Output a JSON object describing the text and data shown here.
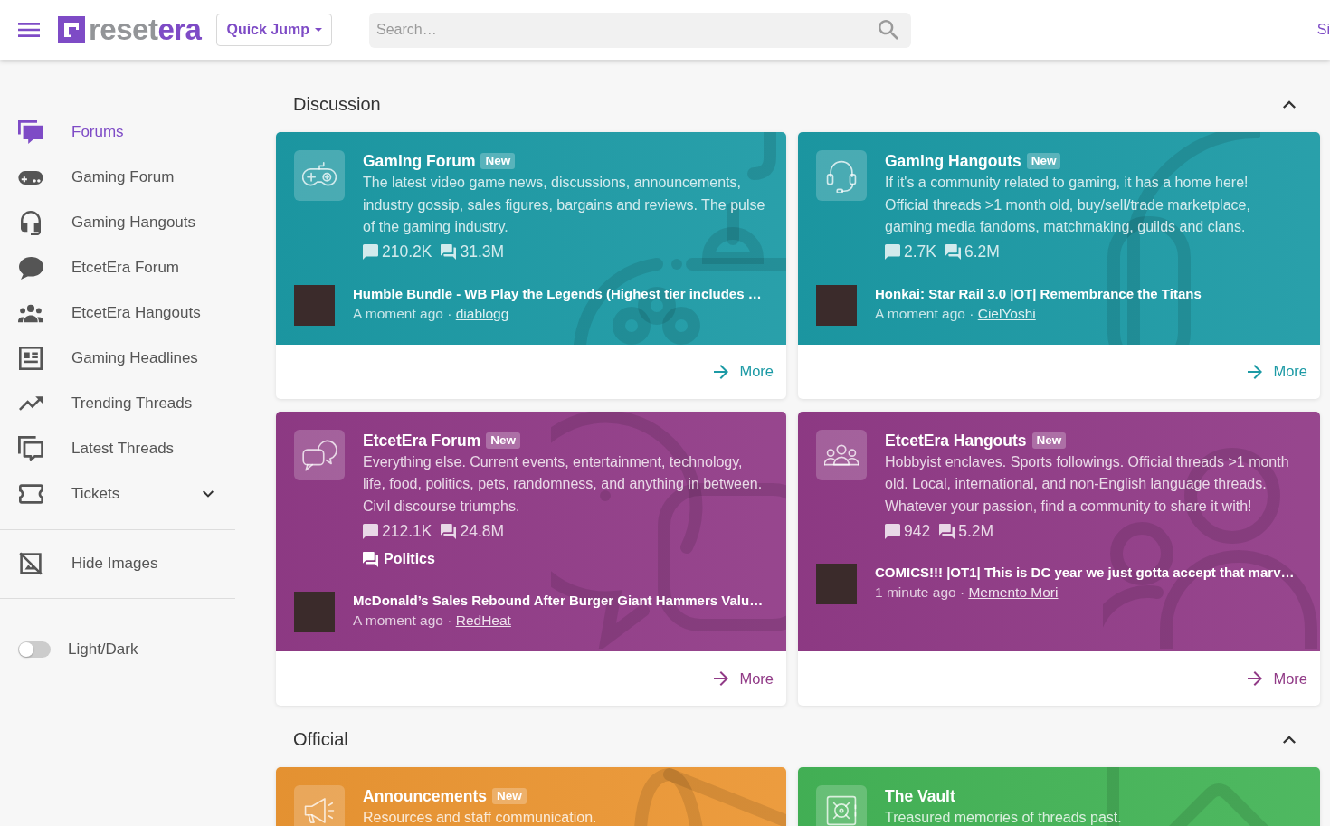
{
  "header": {
    "logo": {
      "wordmark": "reset",
      "wordmark_accent": "era"
    },
    "quick_jump": "Quick Jump",
    "search": {
      "placeholder": "Search…"
    },
    "account_link": "Si"
  },
  "sidebar": {
    "items": [
      {
        "label": "Forums",
        "selected": true,
        "kind": "link"
      },
      {
        "label": "Gaming Forum",
        "selected": false,
        "kind": "link"
      },
      {
        "label": "Gaming Hangouts",
        "selected": false,
        "kind": "link"
      },
      {
        "label": "EtcetEra Forum",
        "selected": false,
        "kind": "link"
      },
      {
        "label": "EtcetEra Hangouts",
        "selected": false,
        "kind": "link"
      },
      {
        "label": "Gaming Headlines",
        "selected": false,
        "kind": "link"
      },
      {
        "label": "Trending Threads",
        "selected": false,
        "kind": "link"
      },
      {
        "label": "Latest Threads",
        "selected": false,
        "kind": "link"
      },
      {
        "label": "Tickets",
        "selected": false,
        "kind": "dropdown",
        "expanded": false
      }
    ],
    "hide_images": {
      "label": "Hide Images"
    },
    "theme_toggle": {
      "label": "Light/Dark",
      "on": false
    }
  },
  "sections": [
    {
      "title": "Discussion",
      "expanded": true,
      "forums": [
        {
          "title": "Gaming Forum",
          "badge": "New",
          "color": "#1c9aa5",
          "description": "The latest video game news, discussions, announcements, industry gossip, sales figures, bargains and reviews. The pulse of the gaming industry.",
          "threads": "210.2K",
          "messages": "31.3M",
          "latest": {
            "title": "Humble Bundle - WB Play the Legends (Highest tier includes …",
            "time": "A moment ago",
            "separator": "·",
            "author": "diablogg"
          },
          "more": "More"
        },
        {
          "title": "Gaming Hangouts",
          "badge": "New",
          "color": "#1c9aa5",
          "description": "If it's a community related to gaming, it has a home here! Official threads >1 month old, buy/sell/trade marketplace, gaming media fandoms, matchmaking, guilds and clans.",
          "threads": "2.7K",
          "messages": "6.2M",
          "latest": {
            "title": "Honkai: Star Rail 3.0 |OT| Remembrance the Titans",
            "time": "A moment ago",
            "separator": "·",
            "author": "CielYoshi"
          },
          "more": "More"
        },
        {
          "title": "EtcetEra Forum",
          "badge": "New",
          "color": "#913b87",
          "description": "Everything else. Current events, entertainment, technology, life, food, politics, pets, randomness, and anything in between. Civil discourse triumphs.",
          "threads": "212.1K",
          "messages": "24.8M",
          "subforums": [
            {
              "label": "Politics"
            }
          ],
          "latest": {
            "title": "McDonald’s Sales Rebound After Burger Giant Hammers Valu…",
            "time": "A moment ago",
            "separator": "·",
            "author": "RedHeat"
          },
          "more": "More"
        },
        {
          "title": "EtcetEra Hangouts",
          "badge": "New",
          "color": "#913b87",
          "description": "Hobbyist enclaves. Sports followings. Official threads >1 month old. Local, international, and non-English language threads. Whatever your passion, find a community to share it with!",
          "threads": "942",
          "messages": "5.2M",
          "latest": {
            "title": "COMICS!!! |OT1| This is DC year we just gotta accept that marv…",
            "time": "1 minute ago",
            "separator": "·",
            "author": "Memento Mori"
          },
          "more": "More"
        }
      ]
    },
    {
      "title": "Official",
      "expanded": true,
      "forums": [
        {
          "title": "Announcements",
          "badge": "New",
          "color": "#eb9633",
          "description": "Resources and staff communication."
        },
        {
          "title": "The Vault",
          "color": "#44b457",
          "description": "Treasured memories of threads past."
        }
      ]
    }
  ]
}
